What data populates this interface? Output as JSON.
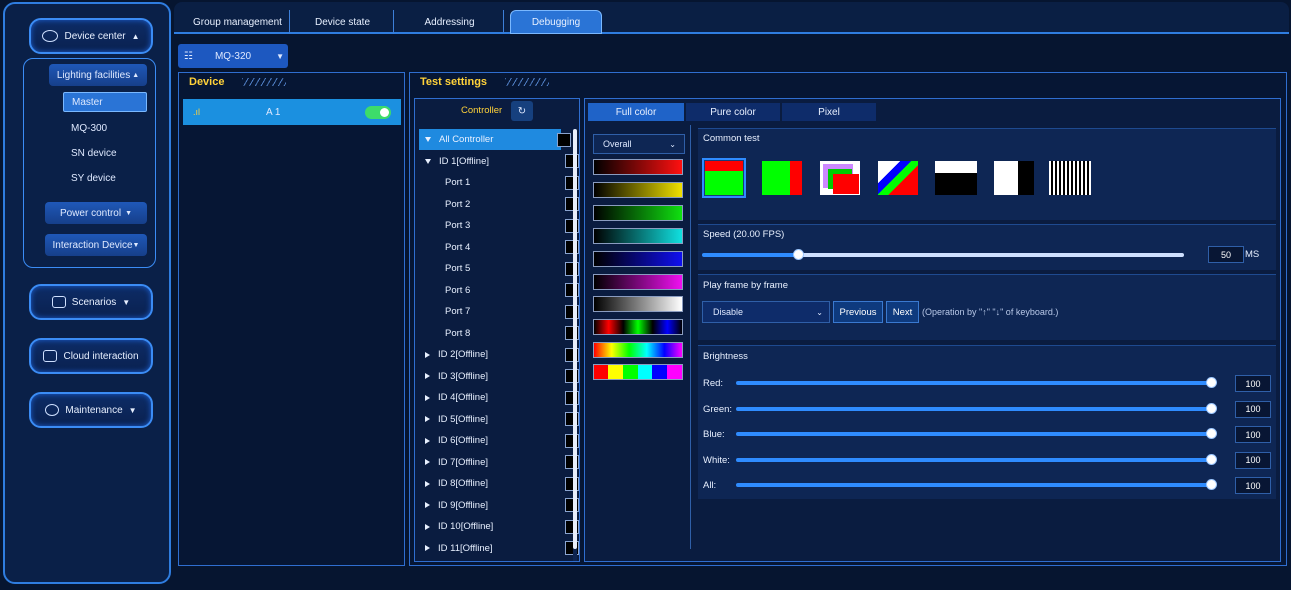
{
  "sidebar": {
    "device_center": "Device center",
    "lighting_facilities": "Lighting facilities",
    "items": [
      "Master",
      "MQ-300",
      "SN device",
      "SY device"
    ],
    "power_control": "Power control",
    "interaction_device": "Interaction Device",
    "scenarios": "Scenarios",
    "cloud_interaction": "Cloud interaction",
    "maintenance": "Maintenance"
  },
  "tabs": [
    "Group management",
    "Device state",
    "Addressing",
    "Debugging"
  ],
  "model": "MQ-320",
  "device_panel": {
    "title": "Device",
    "row_name": "A 1"
  },
  "test_panel": {
    "title": "Test settings",
    "controller_label": "Controller"
  },
  "tree": [
    "All Controller",
    "ID 1[Offline]",
    "Port 1",
    "Port 2",
    "Port 3",
    "Port 4",
    "Port 5",
    "Port 6",
    "Port 7",
    "Port 8",
    "ID 2[Offline]",
    "ID 3[Offline]",
    "ID 4[Offline]",
    "ID 5[Offline]",
    "ID 6[Offline]",
    "ID 7[Offline]",
    "ID 8[Offline]",
    "ID 9[Offline]",
    "ID 10[Offline]",
    "ID 11[Offline]"
  ],
  "color_tabs": [
    "Full color",
    "Pure color",
    "Pixel"
  ],
  "overall_select": "Overall",
  "common_test": "Common test",
  "speed": {
    "label": "Speed  (20.00 FPS)",
    "value": "50",
    "unit": "MS",
    "fraction": 0.2
  },
  "frame": {
    "label": "Play frame by frame",
    "select": "Disable",
    "previous": "Previous",
    "next": "Next",
    "hint": "(Operation by \"↑\" \"↓\" of keyboard.)"
  },
  "brightness": {
    "label": "Brightness",
    "rows": [
      {
        "name": "Red:",
        "value": "100"
      },
      {
        "name": "Green:",
        "value": "100"
      },
      {
        "name": "Blue:",
        "value": "100"
      },
      {
        "name": "White:",
        "value": "100"
      },
      {
        "name": "All:",
        "value": "100"
      }
    ]
  },
  "colors": {
    "accent": "#2a74d6",
    "title": "#ffd23a",
    "toggle": "#3ddc6a"
  }
}
